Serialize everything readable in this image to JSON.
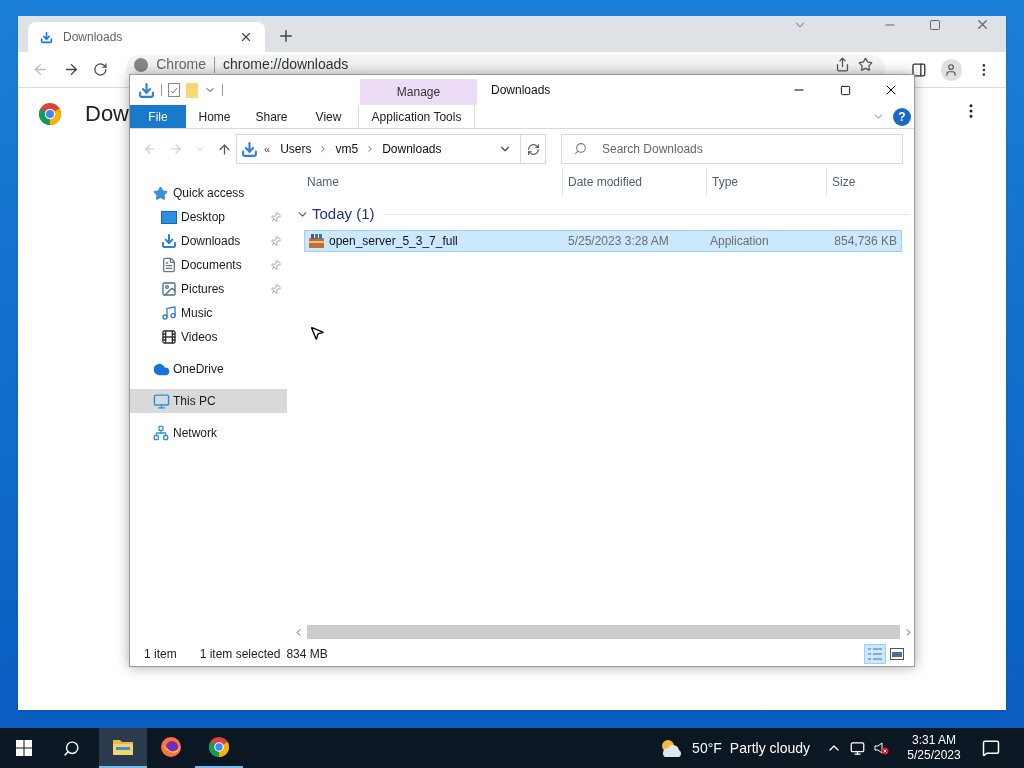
{
  "chrome": {
    "tab": {
      "title": "Downloads"
    },
    "omnibox": {
      "site": "Chrome",
      "url": "chrome://downloads"
    },
    "page_heading": "Dow"
  },
  "explorer": {
    "title": "Downloads",
    "context_group": "Manage",
    "ribbon_tabs": [
      {
        "label": "File",
        "kind": "file"
      },
      {
        "label": "Home",
        "kind": "tab"
      },
      {
        "label": "Share",
        "kind": "tab"
      },
      {
        "label": "View",
        "kind": "tab"
      },
      {
        "label": "Application Tools",
        "kind": "context"
      }
    ],
    "help_label": "?",
    "breadcrumb_overflow": "«",
    "breadcrumb": [
      "Users",
      "vm5",
      "Downloads"
    ],
    "search": {
      "placeholder": "Search Downloads"
    },
    "nav": [
      {
        "label": "Quick access",
        "kind": "star",
        "selected": false,
        "children": [
          {
            "label": "Desktop",
            "kind": "desktop",
            "pinned": true,
            "selected": false
          },
          {
            "label": "Downloads",
            "kind": "download",
            "pinned": true,
            "selected": false
          },
          {
            "label": "Documents",
            "kind": "document",
            "pinned": true,
            "selected": false
          },
          {
            "label": "Pictures",
            "kind": "picture",
            "pinned": true,
            "selected": false
          },
          {
            "label": "Music",
            "kind": "music",
            "pinned": false,
            "selected": false
          },
          {
            "label": "Videos",
            "kind": "video",
            "pinned": false,
            "selected": false
          }
        ]
      },
      {
        "label": "OneDrive",
        "kind": "cloud",
        "selected": false
      },
      {
        "label": "This PC",
        "kind": "pc",
        "selected": true
      },
      {
        "label": "Network",
        "kind": "network",
        "selected": false
      }
    ],
    "columns": [
      "Name",
      "Date modified",
      "Type",
      "Size"
    ],
    "groups": [
      {
        "label": "Today (1)",
        "expanded": true,
        "rows": [
          {
            "name": "open_server_5_3_7_full",
            "date": "5/25/2023 3:28 AM",
            "type": "Application",
            "size": "854,736 KB",
            "selected": true
          }
        ]
      }
    ],
    "status_bar": {
      "count": "1 item",
      "selection": "1 item selected",
      "size": "834 MB"
    },
    "view_buttons": [
      {
        "kind": "details",
        "selected": true
      },
      {
        "kind": "large",
        "selected": false
      }
    ]
  },
  "taskbar": {
    "apps": [
      {
        "kind": "explorer",
        "selected": true,
        "running": true
      },
      {
        "kind": "firefox",
        "selected": false,
        "running": false
      },
      {
        "kind": "chrome",
        "selected": false,
        "running": true
      }
    ],
    "weather": {
      "temperature": "50°F",
      "condition": "Partly cloudy"
    },
    "clock": {
      "time": "3:31 AM",
      "date": "5/25/2023"
    }
  }
}
